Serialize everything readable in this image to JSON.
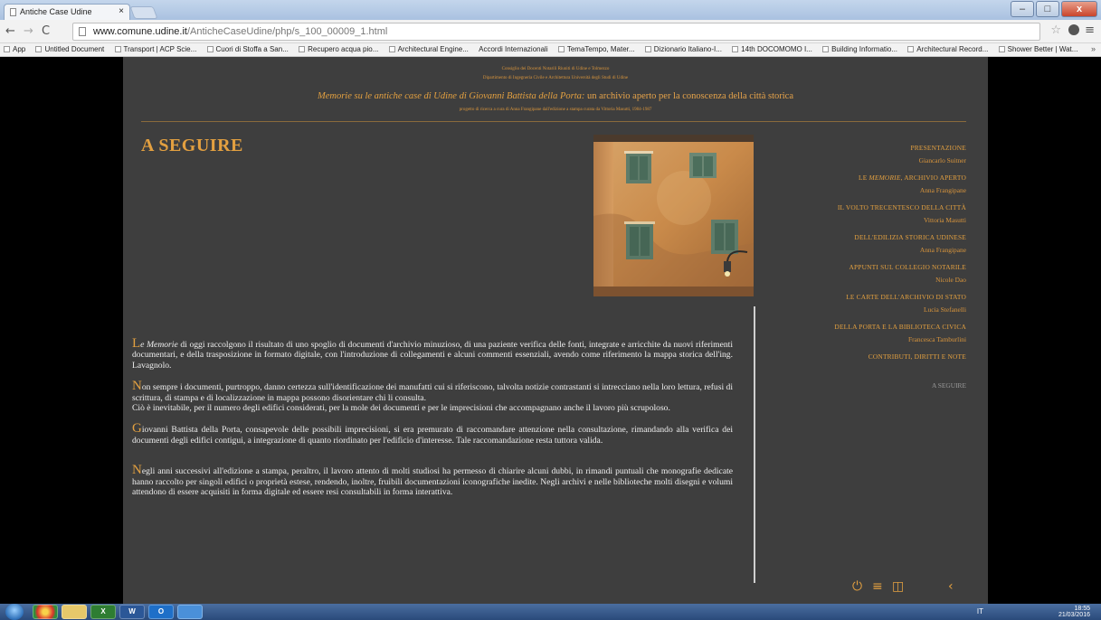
{
  "browser": {
    "tab_title": "Antiche Case Udine",
    "tab_close": "×",
    "url_host": "www.comune.udine.it",
    "url_path": "/AnticheCaseUdine/php/s_100_00009_1.html",
    "bookmarks": [
      "App",
      "Untitled Document",
      "Transport | ACP Scie...",
      "Cuori di Stoffa a San...",
      "Recupero acqua pio...",
      "Architectural Engine...",
      "Accordi Internazionali",
      "TemaTempo, Mater...",
      "Dizionario Italiano-I...",
      "14th DOCOMOMO I...",
      "Building Informatio...",
      "Architectural Record...",
      "Shower Better | Wat..."
    ],
    "bookmarks_more": "»"
  },
  "header": {
    "line1": "Consiglio dei Docenti Notarili Riuniti di Udine e Tolmezzo",
    "line2": "Dipartimento di Ingegneria Civile e Architettura Università degli Studi di Udine",
    "main_italic": "Memorie su le antiche case di Udine di Giovanni Battista della Porta:",
    "main_rest": " un archivio aperto per la conoscenza della città storica",
    "line4": "progetto di ricerca a cura di Anna Frangipane dall'edizione a stampa curata da Vittoria Masutti, 1984-1987"
  },
  "page_title": "A SEGUIRE",
  "paragraphs": {
    "p1_cap": "L",
    "p1_em": "e Memorie",
    "p1_text": " di oggi raccolgono il risultato di uno spoglio di documenti d'archivio minuzioso, di una paziente verifica delle fonti, integrate e arricchite da nuovi riferimenti documentari, e della trasposizione in formato digitale, con l'introduzione di collegamenti e alcuni commenti essenziali, avendo come riferimento la mappa storica dell'ing. Lavagnolo.",
    "p2_cap": "N",
    "p2_text": "on sempre i documenti, purtroppo, danno certezza sull'identificazione dei manufatti cui si riferiscono, talvolta notizie contrastanti si intrecciano nella loro lettura, refusi di scrittura, di stampa e di localizzazione in mappa possono disorientare chi li consulta.",
    "p2_text2": "Ciò è inevitabile, per il numero degli edifici considerati, per la mole dei documenti e per le imprecisioni che accompagnano anche il lavoro più scrupoloso.",
    "p3_cap": "G",
    "p3_text": "iovanni Battista della Porta, consapevole delle possibili imprecisioni, si era premurato di raccomandare attenzione nella consultazione, rimandando alla verifica dei documenti degli edifici contigui, a integrazione di quanto riordinato per l'edificio d'interesse. Tale raccomandazione resta tuttora valida.",
    "p4_cap": "N",
    "p4_text": "egli anni successivi all'edizione a stampa, peraltro, il lavoro attento di molti studiosi ha permesso di chiarire alcuni dubbi, in rimandi puntuali che monografie dedicate hanno raccolto per singoli edifici o proprietà estese, rendendo, inoltre, fruibili documentazioni iconografiche inedite. Negli archivi e nelle biblioteche molti disegni e volumi attendono di essere acquisiti in forma digitale ed essere resi consultabili in forma interattiva."
  },
  "nav": {
    "items": [
      {
        "title": "PRESENTAZIONE",
        "author": "Giancarlo Suitner"
      },
      {
        "title_pre": "LE ",
        "title_em": "MEMORIE",
        "title_post": ", ARCHIVIO APERTO",
        "author": "Anna Frangipane"
      },
      {
        "title": "IL VOLTO TRECENTESCO DELLA CITTÀ",
        "author": "Vittoria Masutti"
      },
      {
        "title": "DELL'EDILIZIA STORICA UDINESE",
        "author": "Anna Frangipane"
      },
      {
        "title": "APPUNTI SUL COLLEGIO NOTARILE",
        "author": "Nicole Dao"
      },
      {
        "title": "LE CARTE DELL'ARCHIVIO DI STATO",
        "author": "Lucia Stefanelli"
      },
      {
        "title": "DELLA PORTA E LA BIBLIOTECA CIVICA",
        "author": "Francesca Tamburlini"
      },
      {
        "title": "CONTRIBUTI, DIRITTI E NOTE"
      }
    ],
    "current": "A SEGUIRE"
  },
  "controls": {
    "power_icon": "⏻",
    "list_icon": "≡",
    "columns_icon": "◫",
    "back_icon": "‹"
  },
  "taskbar": {
    "apps": [
      "X",
      "W",
      "O"
    ],
    "lang": "IT",
    "time": "18:55",
    "date": "21/03/2016"
  },
  "colors": {
    "accent": "#e3a040",
    "background": "#3e3e3e",
    "text": "#f0f0f0",
    "muted": "#9a9a9a"
  }
}
